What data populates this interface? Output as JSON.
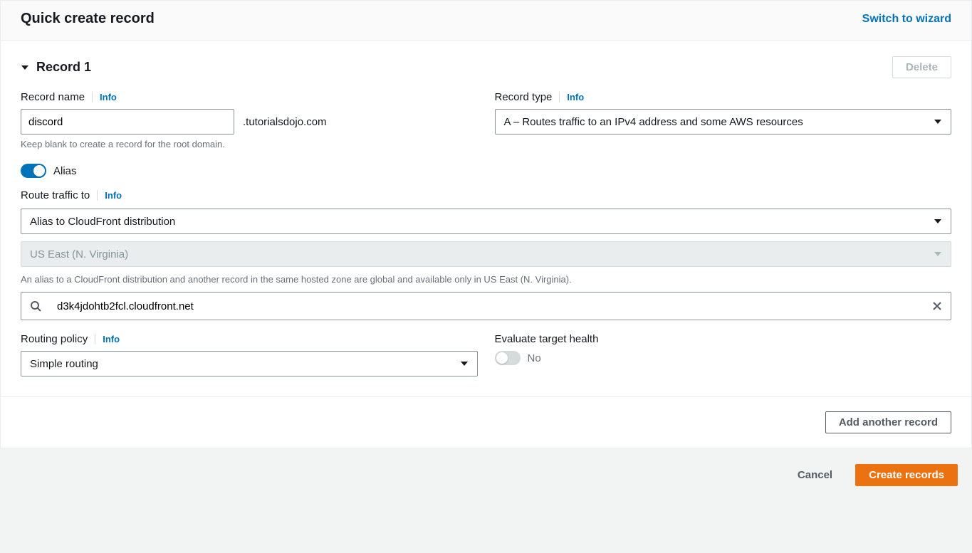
{
  "header": {
    "title": "Quick create record",
    "switch_link": "Switch to wizard"
  },
  "record": {
    "title": "Record 1",
    "delete_label": "Delete",
    "name": {
      "label": "Record name",
      "info": "Info",
      "value": "discord",
      "suffix": ".tutorialsdojo.com",
      "help": "Keep blank to create a record for the root domain."
    },
    "type": {
      "label": "Record type",
      "info": "Info",
      "value": "A – Routes traffic to an IPv4 address and some AWS resources"
    },
    "alias": {
      "label": "Alias",
      "on": true
    },
    "route": {
      "label": "Route traffic to",
      "info": "Info",
      "endpoint": "Alias to CloudFront distribution",
      "region": "US East (N. Virginia)",
      "region_help": "An alias to a CloudFront distribution and another record in the same hosted zone are global and available only in US East (N. Virginia).",
      "target": "d3k4jdohtb2fcl.cloudfront.net"
    },
    "routing": {
      "label": "Routing policy",
      "info": "Info",
      "value": "Simple routing"
    },
    "health": {
      "label": "Evaluate target health",
      "value": "No",
      "on": false
    }
  },
  "actions": {
    "add_another": "Add another record",
    "cancel": "Cancel",
    "create": "Create records"
  }
}
